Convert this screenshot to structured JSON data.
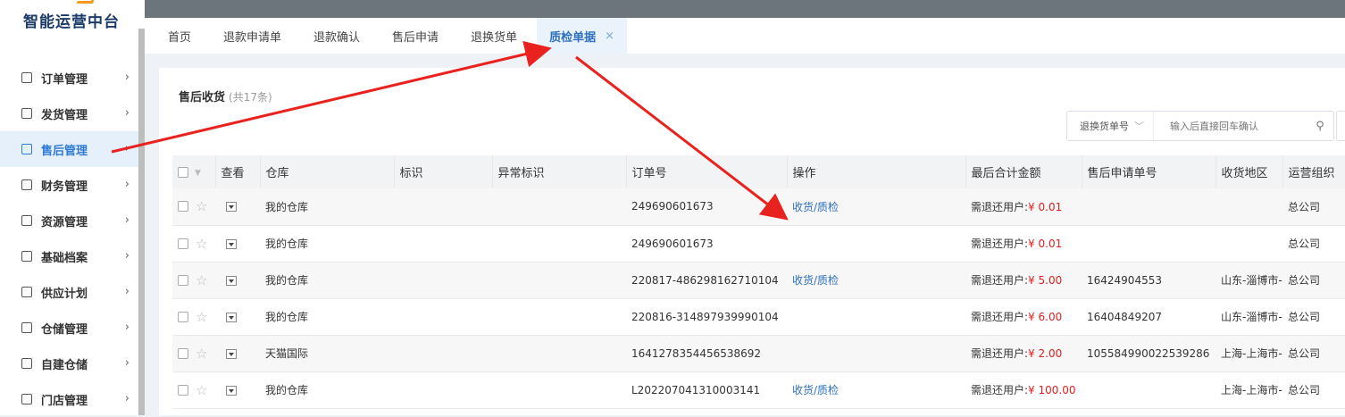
{
  "app": {
    "title": "智能运营中台"
  },
  "sidebar": {
    "items": [
      {
        "label": "订单管理",
        "icon": "order-icon",
        "active": false
      },
      {
        "label": "发货管理",
        "icon": "shipping-icon",
        "active": false
      },
      {
        "label": "售后管理",
        "icon": "after-sales-icon",
        "active": true
      },
      {
        "label": "财务管理",
        "icon": "finance-icon",
        "active": false
      },
      {
        "label": "资源管理",
        "icon": "resource-icon",
        "active": false
      },
      {
        "label": "基础档案",
        "icon": "archive-icon",
        "active": false
      },
      {
        "label": "供应计划",
        "icon": "supply-plan-icon",
        "active": false
      },
      {
        "label": "仓储管理",
        "icon": "warehouse-icon",
        "active": false
      },
      {
        "label": "自建仓储",
        "icon": "self-warehouse-icon",
        "active": false
      },
      {
        "label": "门店管理",
        "icon": "store-icon",
        "active": false
      }
    ]
  },
  "tabs": [
    {
      "label": "首页"
    },
    {
      "label": "退款申请单"
    },
    {
      "label": "退款确认"
    },
    {
      "label": "售后申请"
    },
    {
      "label": "退换货单"
    },
    {
      "label": "质检单据",
      "active": true,
      "close": "×"
    }
  ],
  "panel": {
    "title": "售后收货",
    "count": "(共17条)"
  },
  "search": {
    "field": "退换货单号",
    "placeholder": "输入后直接回车确认"
  },
  "table": {
    "headers": [
      "查看",
      "仓库",
      "标识",
      "异常标识",
      "订单号",
      "操作",
      "最后合计金额",
      "售后申请单号",
      "收货地区",
      "运营组织"
    ],
    "rows": [
      {
        "warehouse": "我的仓库",
        "order": "249690601673",
        "action": "收货/质检",
        "amount_label": "需退还用户:",
        "amount": "¥ 0.01",
        "apply_no": "",
        "region": "",
        "org": "总公司"
      },
      {
        "warehouse": "我的仓库",
        "order": "249690601673",
        "action": "",
        "amount_label": "需退还用户:",
        "amount": "¥ 0.01",
        "apply_no": "",
        "region": "",
        "org": "总公司"
      },
      {
        "warehouse": "我的仓库",
        "order": "220817-486298162710104",
        "action": "收货/质检",
        "amount_label": "需退还用户:",
        "amount": "¥ 5.00",
        "apply_no": "16424904553",
        "region": "山东-淄博市-",
        "org": "总公司"
      },
      {
        "warehouse": "我的仓库",
        "order": "220816-314897939990104",
        "action": "",
        "amount_label": "需退还用户:",
        "amount": "¥ 6.00",
        "apply_no": "16404849207",
        "region": "山东-淄博市-",
        "org": "总公司"
      },
      {
        "warehouse": "天猫国际",
        "order": "1641278354456538692",
        "action": "",
        "amount_label": "需退还用户:",
        "amount": "¥ 2.00",
        "apply_no": "105584990022539286",
        "region": "上海-上海市-",
        "org": "总公司"
      },
      {
        "warehouse": "我的仓库",
        "order": "L202207041310003141",
        "action": "收货/质检",
        "amount_label": "需退还用户:",
        "amount": "¥ 100.00",
        "apply_no": "",
        "region": "上海-上海市-",
        "org": "总公司"
      }
    ]
  },
  "colors": {
    "accent": "#2f6fbf",
    "money": "#e02020",
    "arrow": "#e8231f"
  }
}
